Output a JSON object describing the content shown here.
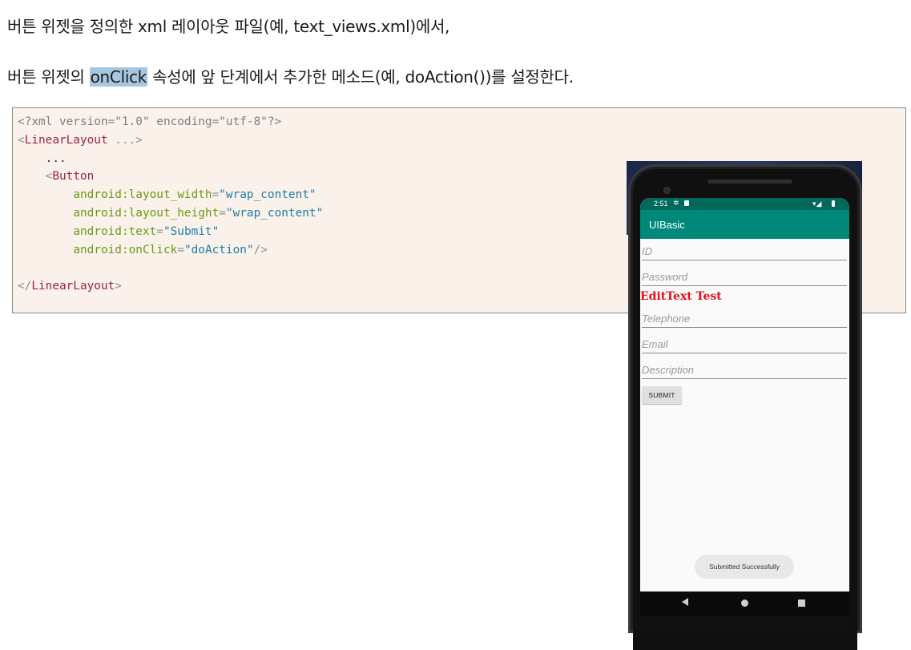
{
  "text": {
    "line1": "버튼 위젯을 정의한 xml 레이아웃 파일(예, text_views.xml)에서,",
    "line2_before": "버튼 위젯의 ",
    "line2_highlight": "onClick",
    "line2_after": " 속성에 앞 단계에서 추가한 메소드(예, doAction())를 설정한다."
  },
  "code": {
    "l1": "<?xml version=\"1.0\" encoding=\"utf-8\"?>",
    "l2_tag": "LinearLayout",
    "l2_rest": " ...",
    "l3": "    ...",
    "l4_tag": "Button",
    "attrs": [
      {
        "name": "android:layout_width",
        "value": "\"wrap_content\""
      },
      {
        "name": "android:layout_height",
        "value": "\"wrap_content\""
      },
      {
        "name": "android:text",
        "value": "\"Submit\""
      },
      {
        "name": "android:onClick",
        "value": "\"doAction\""
      }
    ],
    "close_tag": "LinearLayout"
  },
  "phone": {
    "status_time": "2:51",
    "app_title": "UIBasic",
    "fields": {
      "id": "ID",
      "password": "Password",
      "telephone": "Telephone",
      "email": "Email",
      "description": "Description"
    },
    "red_label": "EditText Test",
    "submit_label": "SUBMIT",
    "toast": "Submitted Successfully"
  },
  "colors": {
    "highlight": "#a7c6e0",
    "code_bg": "#f9f1ea",
    "status_bar": "#00695c",
    "app_bar": "#00897b",
    "red_label": "#e5101a"
  }
}
